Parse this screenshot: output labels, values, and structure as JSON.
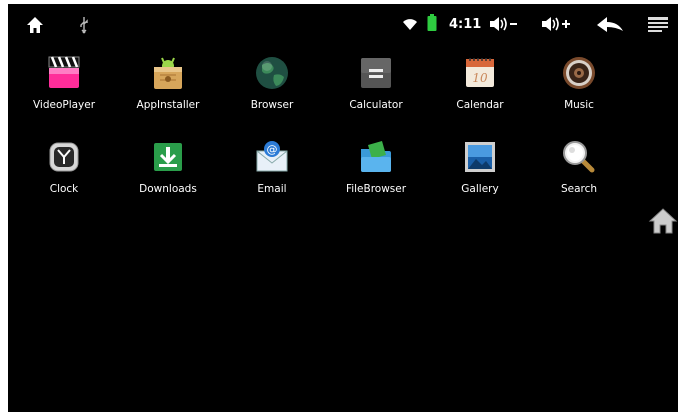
{
  "statusbar": {
    "time": "4:11",
    "icons": {
      "home": "home-icon",
      "usb": "usb-icon",
      "wifi": "wifi-icon",
      "battery": "battery-icon",
      "volume_down": "volume-down-icon",
      "volume_up": "volume-up-icon",
      "back": "back-arrow-icon",
      "menu": "menu-icon"
    },
    "battery_color": "#2ecc40"
  },
  "apps": [
    {
      "label": "VideoPlayer",
      "icon": "video-player-icon"
    },
    {
      "label": "AppInstaller",
      "icon": "app-installer-icon"
    },
    {
      "label": "Browser",
      "icon": "browser-icon"
    },
    {
      "label": "Calculator",
      "icon": "calculator-icon"
    },
    {
      "label": "Calendar",
      "icon": "calendar-icon"
    },
    {
      "label": "Music",
      "icon": "music-icon"
    },
    {
      "label": "Clock",
      "icon": "clock-icon"
    },
    {
      "label": "Downloads",
      "icon": "downloads-icon"
    },
    {
      "label": "Email",
      "icon": "email-icon"
    },
    {
      "label": "FileBrowser",
      "icon": "file-browser-icon"
    },
    {
      "label": "Gallery",
      "icon": "gallery-icon"
    },
    {
      "label": "Search",
      "icon": "search-icon"
    }
  ],
  "side": {
    "home_icon": "home-icon"
  }
}
